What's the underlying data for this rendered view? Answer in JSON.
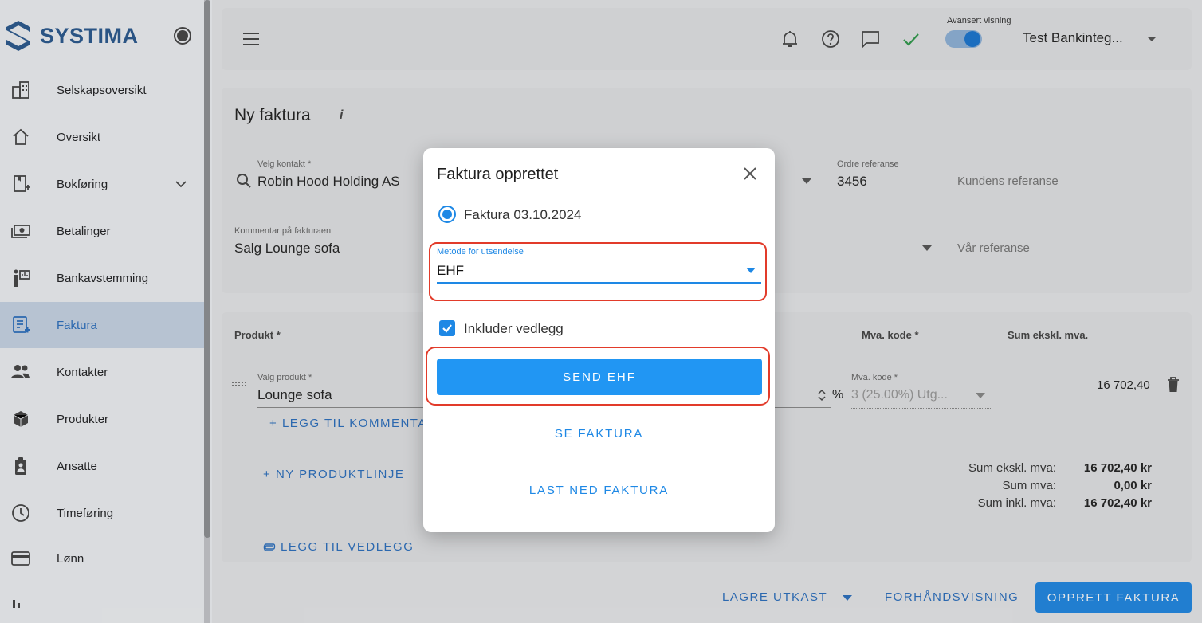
{
  "brand": {
    "name": "SYSTIMA",
    "color": "#28588f"
  },
  "sidebar": {
    "items": [
      {
        "label": "Selskapsoversikt",
        "icon": "building-icon"
      },
      {
        "label": "Oversikt",
        "icon": "home-icon"
      },
      {
        "label": "Bokføring",
        "icon": "ledger-add-icon",
        "expandable": true
      },
      {
        "label": "Betalinger",
        "icon": "money-icon"
      },
      {
        "label": "Bankavstemming",
        "icon": "reconcile-icon"
      },
      {
        "label": "Faktura",
        "icon": "invoice-icon",
        "active": true
      },
      {
        "label": "Kontakter",
        "icon": "people-icon"
      },
      {
        "label": "Produkter",
        "icon": "box-icon"
      },
      {
        "label": "Ansatte",
        "icon": "badge-icon"
      },
      {
        "label": "Timeføring",
        "icon": "clock-icon"
      },
      {
        "label": "Lønn",
        "icon": "card-icon"
      }
    ]
  },
  "header": {
    "advanced_label": "Avansert visning",
    "advanced_on": true,
    "company": "Test Bankinteg..."
  },
  "form": {
    "title": "Ny faktura",
    "info": "i",
    "contact_label": "Velg kontakt *",
    "contact_value": "Robin Hood Holding AS",
    "order_ref_label": "Ordre referanse",
    "order_ref_value": "3456",
    "customer_ref_placeholder": "Kundens referanse",
    "comment_label": "Kommentar på fakturaen",
    "comment_value": "Salg Lounge sofa",
    "our_ref_placeholder": "Vår referanse"
  },
  "lines": {
    "col_product": "Produkt *",
    "col_vat": "Mva. kode *",
    "col_sum": "Sum ekskl. mva.",
    "product_label": "Valg produkt *",
    "product_value": "Lounge sofa",
    "percent_sign": "%",
    "vat_label": "Mva. kode *",
    "vat_value": "3 (25.00%) Utg...",
    "line_sum": "16 702,40",
    "add_comment": "LEGG TIL KOMMENTA",
    "new_line": "NY PRODUKTLINJE",
    "add_attachment": "LEGG TIL VEDLEGG",
    "totals": [
      {
        "label": "Sum ekskl. mva:",
        "value": "16 702,40 kr"
      },
      {
        "label": "Sum mva:",
        "value": "0,00 kr"
      },
      {
        "label": "Sum inkl. mva:",
        "value": "16 702,40 kr"
      }
    ]
  },
  "footer": {
    "save_draft": "LAGRE UTKAST",
    "preview": "FORHÅNDSVISNING",
    "create": "OPPRETT FAKTURA"
  },
  "dialog": {
    "title": "Faktura opprettet",
    "radio_label": "Faktura 03.10.2024",
    "method_label": "Metode for utsendelse",
    "method_value": "EHF",
    "include_attachment": "Inkluder vedlegg",
    "send_button": "SEND EHF",
    "view_invoice": "SE FAKTURA",
    "download_invoice": "LAST NED FAKTURA"
  },
  "colors": {
    "primary": "#2196f3",
    "highlight": "#e23b2a",
    "active_nav_bg": "#c9d7e7"
  }
}
